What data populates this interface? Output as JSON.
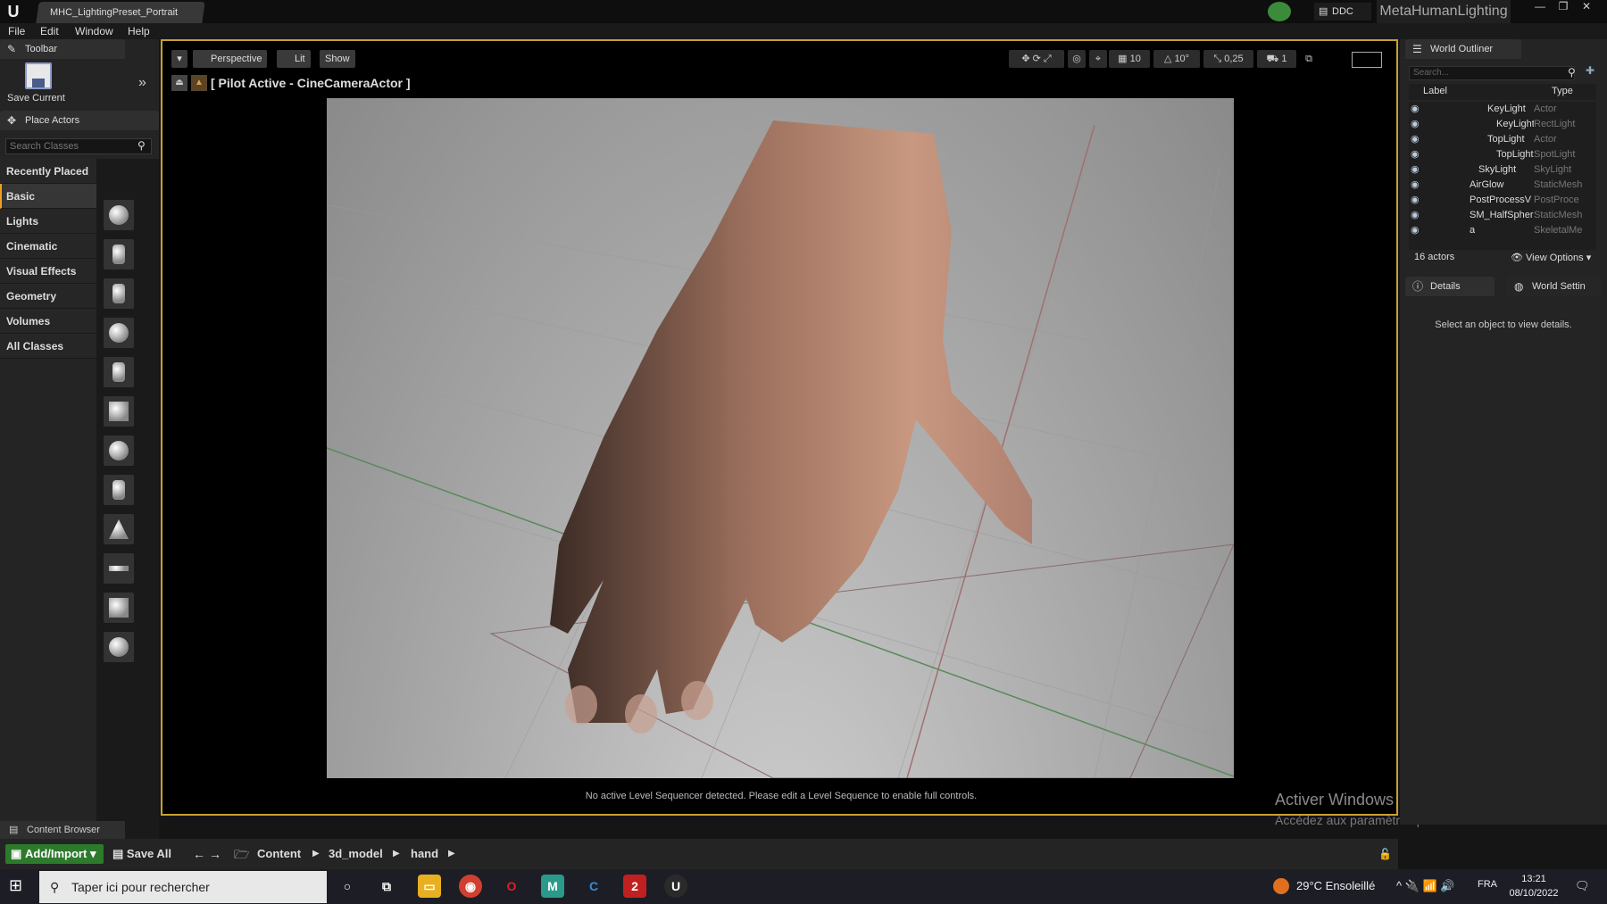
{
  "window": {
    "document_tab": "MHC_LightingPreset_Portrait",
    "ddc_label": "DDC",
    "project_name": "MetaHumanLighting"
  },
  "menu": [
    "File",
    "Edit",
    "Window",
    "Help"
  ],
  "toolbar": {
    "tab_label": "Toolbar",
    "save_current": "Save Current"
  },
  "place_actors": {
    "tab_label": "Place Actors",
    "search_placeholder": "Search Classes",
    "categories": [
      "Recently Placed",
      "Basic",
      "Lights",
      "Cinematic",
      "Visual Effects",
      "Geometry",
      "Volumes",
      "All Classes"
    ],
    "active_category": "Basic"
  },
  "viewport": {
    "perspective": "Perspective",
    "lit": "Lit",
    "show": "Show",
    "pilot_text": "[ Pilot Active - CineCameraActor ]",
    "grid_snap": "10",
    "rotation_snap": "10°",
    "scale_snap": "0,25",
    "status_message": "No active Level Sequencer detected. Please edit a Level Sequence to enable full controls."
  },
  "world_outliner": {
    "tab_label": "World Outliner",
    "search_placeholder": "Search...",
    "columns": {
      "label": "Label",
      "type": "Type"
    },
    "rows": [
      {
        "label": "KeyLight",
        "type": "Actor"
      },
      {
        "label": "KeyLight",
        "type": "RectLight"
      },
      {
        "label": "TopLight",
        "type": "Actor"
      },
      {
        "label": "TopLight",
        "type": "SpotLight"
      },
      {
        "label": "SkyLight",
        "type": "SkyLight"
      },
      {
        "label": "AirGlow",
        "type": "StaticMesh"
      },
      {
        "label": "PostProcessV",
        "type": "PostProce"
      },
      {
        "label": "SM_HalfSpher",
        "type": "StaticMesh"
      },
      {
        "label": "a",
        "type": "SkeletalMe"
      }
    ],
    "actors_count": "16 actors",
    "view_options": "View Options"
  },
  "details": {
    "tab_label": "Details",
    "world_settings_tab": "World Settin",
    "empty_message": "Select an object to view details."
  },
  "content_browser": {
    "tab_label": "Content Browser",
    "add_import": "Add/Import",
    "save_all": "Save All",
    "path": [
      "Content",
      "3d_model",
      "hand"
    ]
  },
  "watermark": {
    "title": "Activer Windows",
    "subtitle": "Accédez aux paramètres pour activer Windows."
  },
  "taskbar": {
    "search_placeholder": "Taper ici pour rechercher",
    "weather": "29°C  Ensoleillé",
    "language": "FRA",
    "time": "13:21",
    "date": "08/10/2022"
  }
}
